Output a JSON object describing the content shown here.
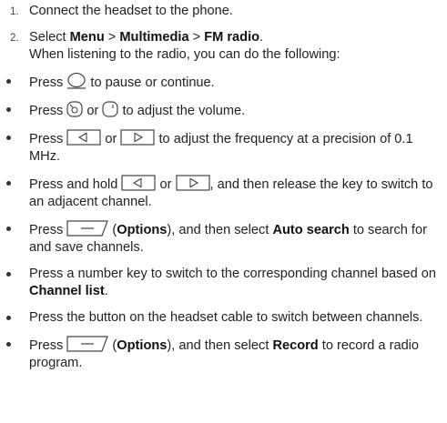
{
  "steps": [
    {
      "num": "1.",
      "text": "Connect the headset to the phone."
    },
    {
      "num": "2.",
      "lead": "Select ",
      "menu": "Menu",
      "sep1": " > ",
      "multimedia": "Multimedia",
      "sep2": " > ",
      "fm": "FM radio",
      "end": ".",
      "sub": "When listening to the radio, you can do the following:"
    }
  ],
  "bullets": {
    "b1": {
      "a": "Press ",
      "icon": "center-key-icon",
      "b": " to pause or continue."
    },
    "b2": {
      "a": "Press ",
      "icon1": "volume-up-key-icon",
      "or": " or ",
      "icon2": "volume-down-key-icon",
      "b": " to adjust the volume."
    },
    "b3": {
      "a": "Press ",
      "icon1": "left-key-icon",
      "or": " or ",
      "icon2": "right-key-icon",
      "b": " to adjust the frequency at a precision of 0.1 MHz."
    },
    "b4": {
      "a": "Press and hold ",
      "icon1": "left-key-icon",
      "or": " or ",
      "icon2": "right-key-icon",
      "b": ", and then release the key to switch to an adjacent channel."
    },
    "b5": {
      "a": "Press ",
      "icon": "left-soft-key-icon",
      "open": " (",
      "options": "Options",
      "mid": "), and then select ",
      "auto": "Auto search",
      "b": " to search for and save channels."
    },
    "b6": {
      "a": "Press a number key to switch to the corresponding channel based on ",
      "channel": "Channel list",
      "b": "."
    },
    "b7": {
      "a": "Press the button on the headset cable to switch between channels."
    },
    "b8": {
      "a": "Press ",
      "icon": "left-soft-key-icon",
      "open": " (",
      "options": "Options",
      "mid": "), and then select ",
      "record": "Record",
      "b": " to record a radio program."
    }
  }
}
